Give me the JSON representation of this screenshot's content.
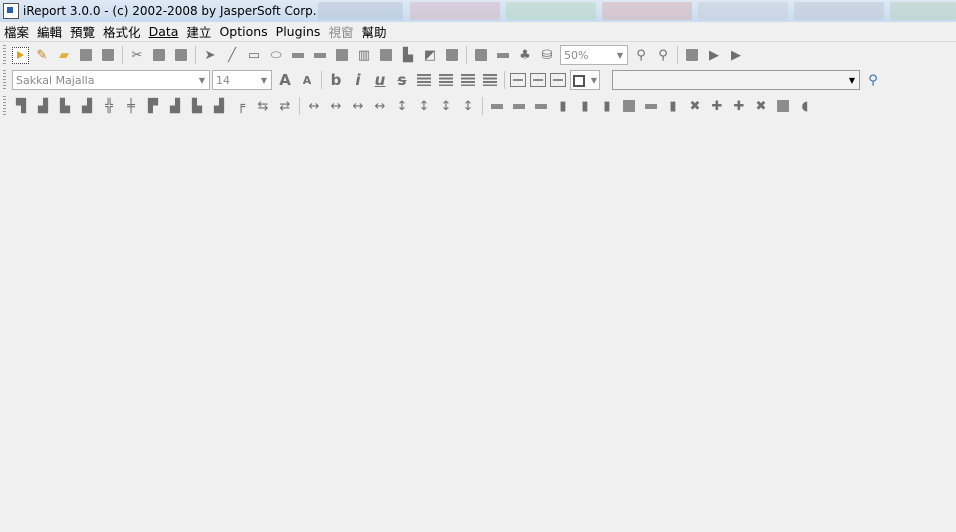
{
  "window": {
    "title": "iReport 3.0.0  - (c) 2002-2008 by JasperSoft Corp."
  },
  "menubar": {
    "items": [
      {
        "label": "檔案",
        "enabled": true
      },
      {
        "label": "編輯",
        "enabled": true
      },
      {
        "label": "預覽",
        "enabled": true
      },
      {
        "label": "格式化",
        "enabled": true
      },
      {
        "label": "Data",
        "enabled": true
      },
      {
        "label": "建立",
        "enabled": true
      },
      {
        "label": "Options",
        "enabled": true
      },
      {
        "label": "Plugins",
        "enabled": true
      },
      {
        "label": "視窗",
        "enabled": false
      },
      {
        "label": "幫助",
        "enabled": true
      }
    ]
  },
  "toolbar_main": {
    "zoom_value": "50%"
  },
  "toolbar_format": {
    "font_name": "Sakkal Majalla",
    "font_size": "14",
    "bold_glyph": "b",
    "italic_glyph": "i",
    "underline_glyph": "u",
    "strike_glyph": "s",
    "increase_font_glyph": "A",
    "decrease_font_glyph": "A",
    "report_selector_value": ""
  },
  "colors": {
    "background": "#f0f0f0",
    "icon_gray": "#8c8c8c",
    "title_bar": "#c9dbef"
  }
}
